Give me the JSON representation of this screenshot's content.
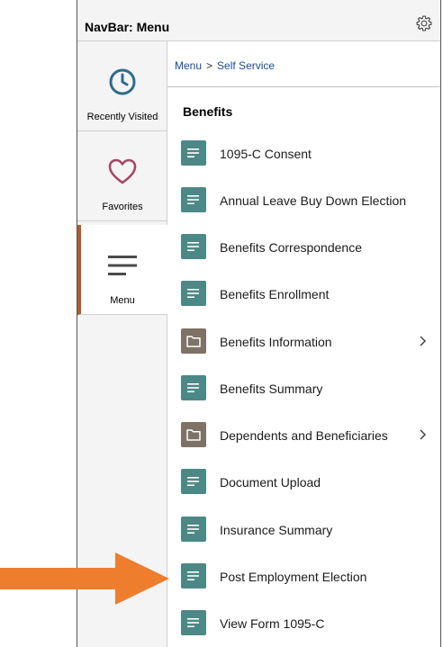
{
  "header": {
    "title": "NavBar: Menu",
    "settings_icon": "gear-icon"
  },
  "sidebar": {
    "items": [
      {
        "label": "Recently Visited",
        "icon": "clock-icon",
        "active": false
      },
      {
        "label": "Favorites",
        "icon": "heart-icon",
        "active": false
      },
      {
        "label": "Menu",
        "icon": "hamburger-icon",
        "active": true
      }
    ]
  },
  "breadcrumb": {
    "root": "Menu",
    "separator": ">",
    "current": "Self Service"
  },
  "section": {
    "title": "Benefits"
  },
  "menu_items": [
    {
      "label": "1095-C Consent",
      "type": "content",
      "has_children": false
    },
    {
      "label": "Annual Leave Buy Down Election",
      "type": "content",
      "has_children": false
    },
    {
      "label": "Benefits Correspondence",
      "type": "content",
      "has_children": false
    },
    {
      "label": "Benefits Enrollment",
      "type": "content",
      "has_children": false
    },
    {
      "label": "Benefits Information",
      "type": "folder",
      "has_children": true
    },
    {
      "label": "Benefits Summary",
      "type": "content",
      "has_children": false
    },
    {
      "label": "Dependents and Beneficiaries",
      "type": "folder",
      "has_children": true
    },
    {
      "label": "Document Upload",
      "type": "content",
      "has_children": false
    },
    {
      "label": "Insurance Summary",
      "type": "content",
      "has_children": false
    },
    {
      "label": "Post Employment Election",
      "type": "content",
      "has_children": false
    },
    {
      "label": "View Form 1095-C",
      "type": "content",
      "has_children": false
    }
  ],
  "colors": {
    "content_tile": "#4c8885",
    "folder_tile": "#7e7266",
    "active_accent": "#b15a2e",
    "clock_icon": "#2d6c8c",
    "heart_icon": "#a8466a",
    "hamburger_icon": "#4a4a4a",
    "callout_arrow": "#ee7d2e",
    "breadcrumb_link": "#1a4b9c"
  },
  "annotation": {
    "arrow_icon": "callout-arrow-icon"
  }
}
